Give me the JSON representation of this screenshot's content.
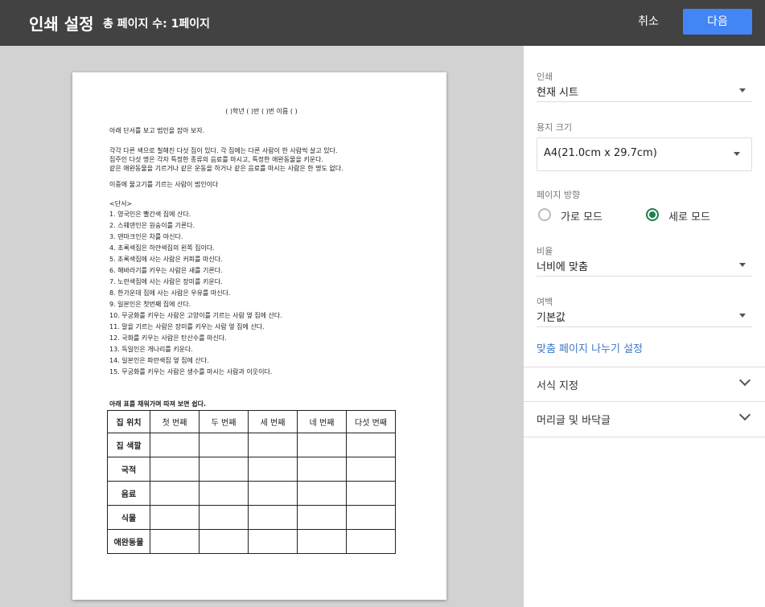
{
  "header": {
    "title": "인쇄 설정",
    "subtitle": "총 페이지 수: 1페이지",
    "cancel_label": "취소",
    "next_label": "다음"
  },
  "document": {
    "name_line": "(  )학년 (  )반 (  )번 이름 (         )",
    "intro": "아래 단서를 보고 범인을 잡아 보자.",
    "paragraph": [
      "각각 다른 색으로 칠해진 다섯 집이 있다. 각 집에는 다른 사람이 한 사람씩 살고 있다.",
      "집주인 다섯 명은 각자 특정한 종류의 음료를 마시고, 특정한 애완동물을 키운다.",
      "같은 애완동물을 기르거나 같은 운동을 하거나 같은 음료를 마시는 사람은 한 명도 없다."
    ],
    "question": "이중에 물고기를 기르는 사람이 범인이다",
    "clues_title": "<단서>",
    "clues": [
      "1. 영국인은 빨간색 집에 산다.",
      "2. 스웨덴인은 원숭이를 기른다.",
      "3. 덴마크인은 차를 마신다.",
      "4. 초록색집은 하얀색집의 왼쪽 집이다.",
      "5. 초록색집에 사는 사람은 커피를 마신다.",
      "6. 해바라기를 키우는 사람은 새를 기른다.",
      "7. 노란색집에 사는 사람은 장미를 키운다.",
      "8. 한가운데 집에 사는 사람은 우유를 마신다.",
      "9. 일본인은 첫번째 집에 산다.",
      "10. 무궁화를 키우는 사람은 고양이를 기르는 사람 옆 집에 산다.",
      "11. 말을 기르는 사람은 장미를 키우는 사람 옆 집에 산다.",
      "12. 국화를 키우는 사람은 탄산수를 마신다.",
      "13. 독일인은 개나리를 키운다.",
      "14. 일본인은 파란색집 옆 집에 산다.",
      "15. 무궁화를 키우는 사람은 생수를 마시는 사람과 이웃이다."
    ],
    "table_caption": "아래 표를 채워가며 따져 보면 쉽다.",
    "table": {
      "header": [
        "집 위치",
        "첫 번째",
        "두 번째",
        "세 번째",
        "네 번째",
        "다섯 번째"
      ],
      "rows": [
        "집 색깔",
        "국적",
        "음료",
        "식물",
        "애완동물"
      ]
    }
  },
  "settings": {
    "print_label": "인쇄",
    "print_value": "현재 시트",
    "paper_label": "용지 크기",
    "paper_value": "A4(21.0cm x 29.7cm)",
    "orientation_label": "페이지 방향",
    "orientation_options": [
      "가로 모드",
      "세로 모드"
    ],
    "orientation_selected": "세로 모드",
    "scale_label": "비율",
    "scale_value": "너비에 맞춤",
    "margin_label": "여백",
    "margin_value": "기본값",
    "custom_breaks_link": "맞춤 페이지 나누기 설정",
    "sections": [
      "서식 지정",
      "머리글 및 바닥글"
    ]
  },
  "colors": {
    "header_bg": "#424242",
    "accent_button": "#4285f4",
    "radio_selected": "#1e7f4c",
    "link": "#3b78c9",
    "preview_bg": "#d2d2d2"
  }
}
